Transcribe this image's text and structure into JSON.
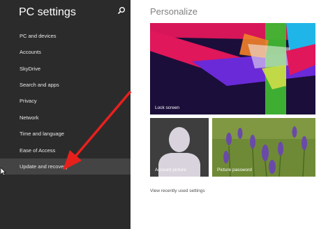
{
  "sidebar": {
    "title": "PC settings",
    "search_icon": "search-icon",
    "items": [
      {
        "label": "PC and devices",
        "active": false
      },
      {
        "label": "Accounts",
        "active": false
      },
      {
        "label": "SkyDrive",
        "active": false
      },
      {
        "label": "Search and apps",
        "active": false
      },
      {
        "label": "Privacy",
        "active": false
      },
      {
        "label": "Network",
        "active": false
      },
      {
        "label": "Time and language",
        "active": false
      },
      {
        "label": "Ease of Access",
        "active": false
      },
      {
        "label": "Update and recovery",
        "active": true
      }
    ]
  },
  "main": {
    "title": "Personalize",
    "tiles": {
      "lock_screen": "Lock screen",
      "account_picture": "Account picture",
      "picture_password": "Picture password"
    },
    "recent_link": "View recently used settings"
  },
  "colors": {
    "sidebar_bg": "#2b2b2b",
    "active_item_bg": "#444444",
    "annotation_arrow": "#e8201c"
  }
}
